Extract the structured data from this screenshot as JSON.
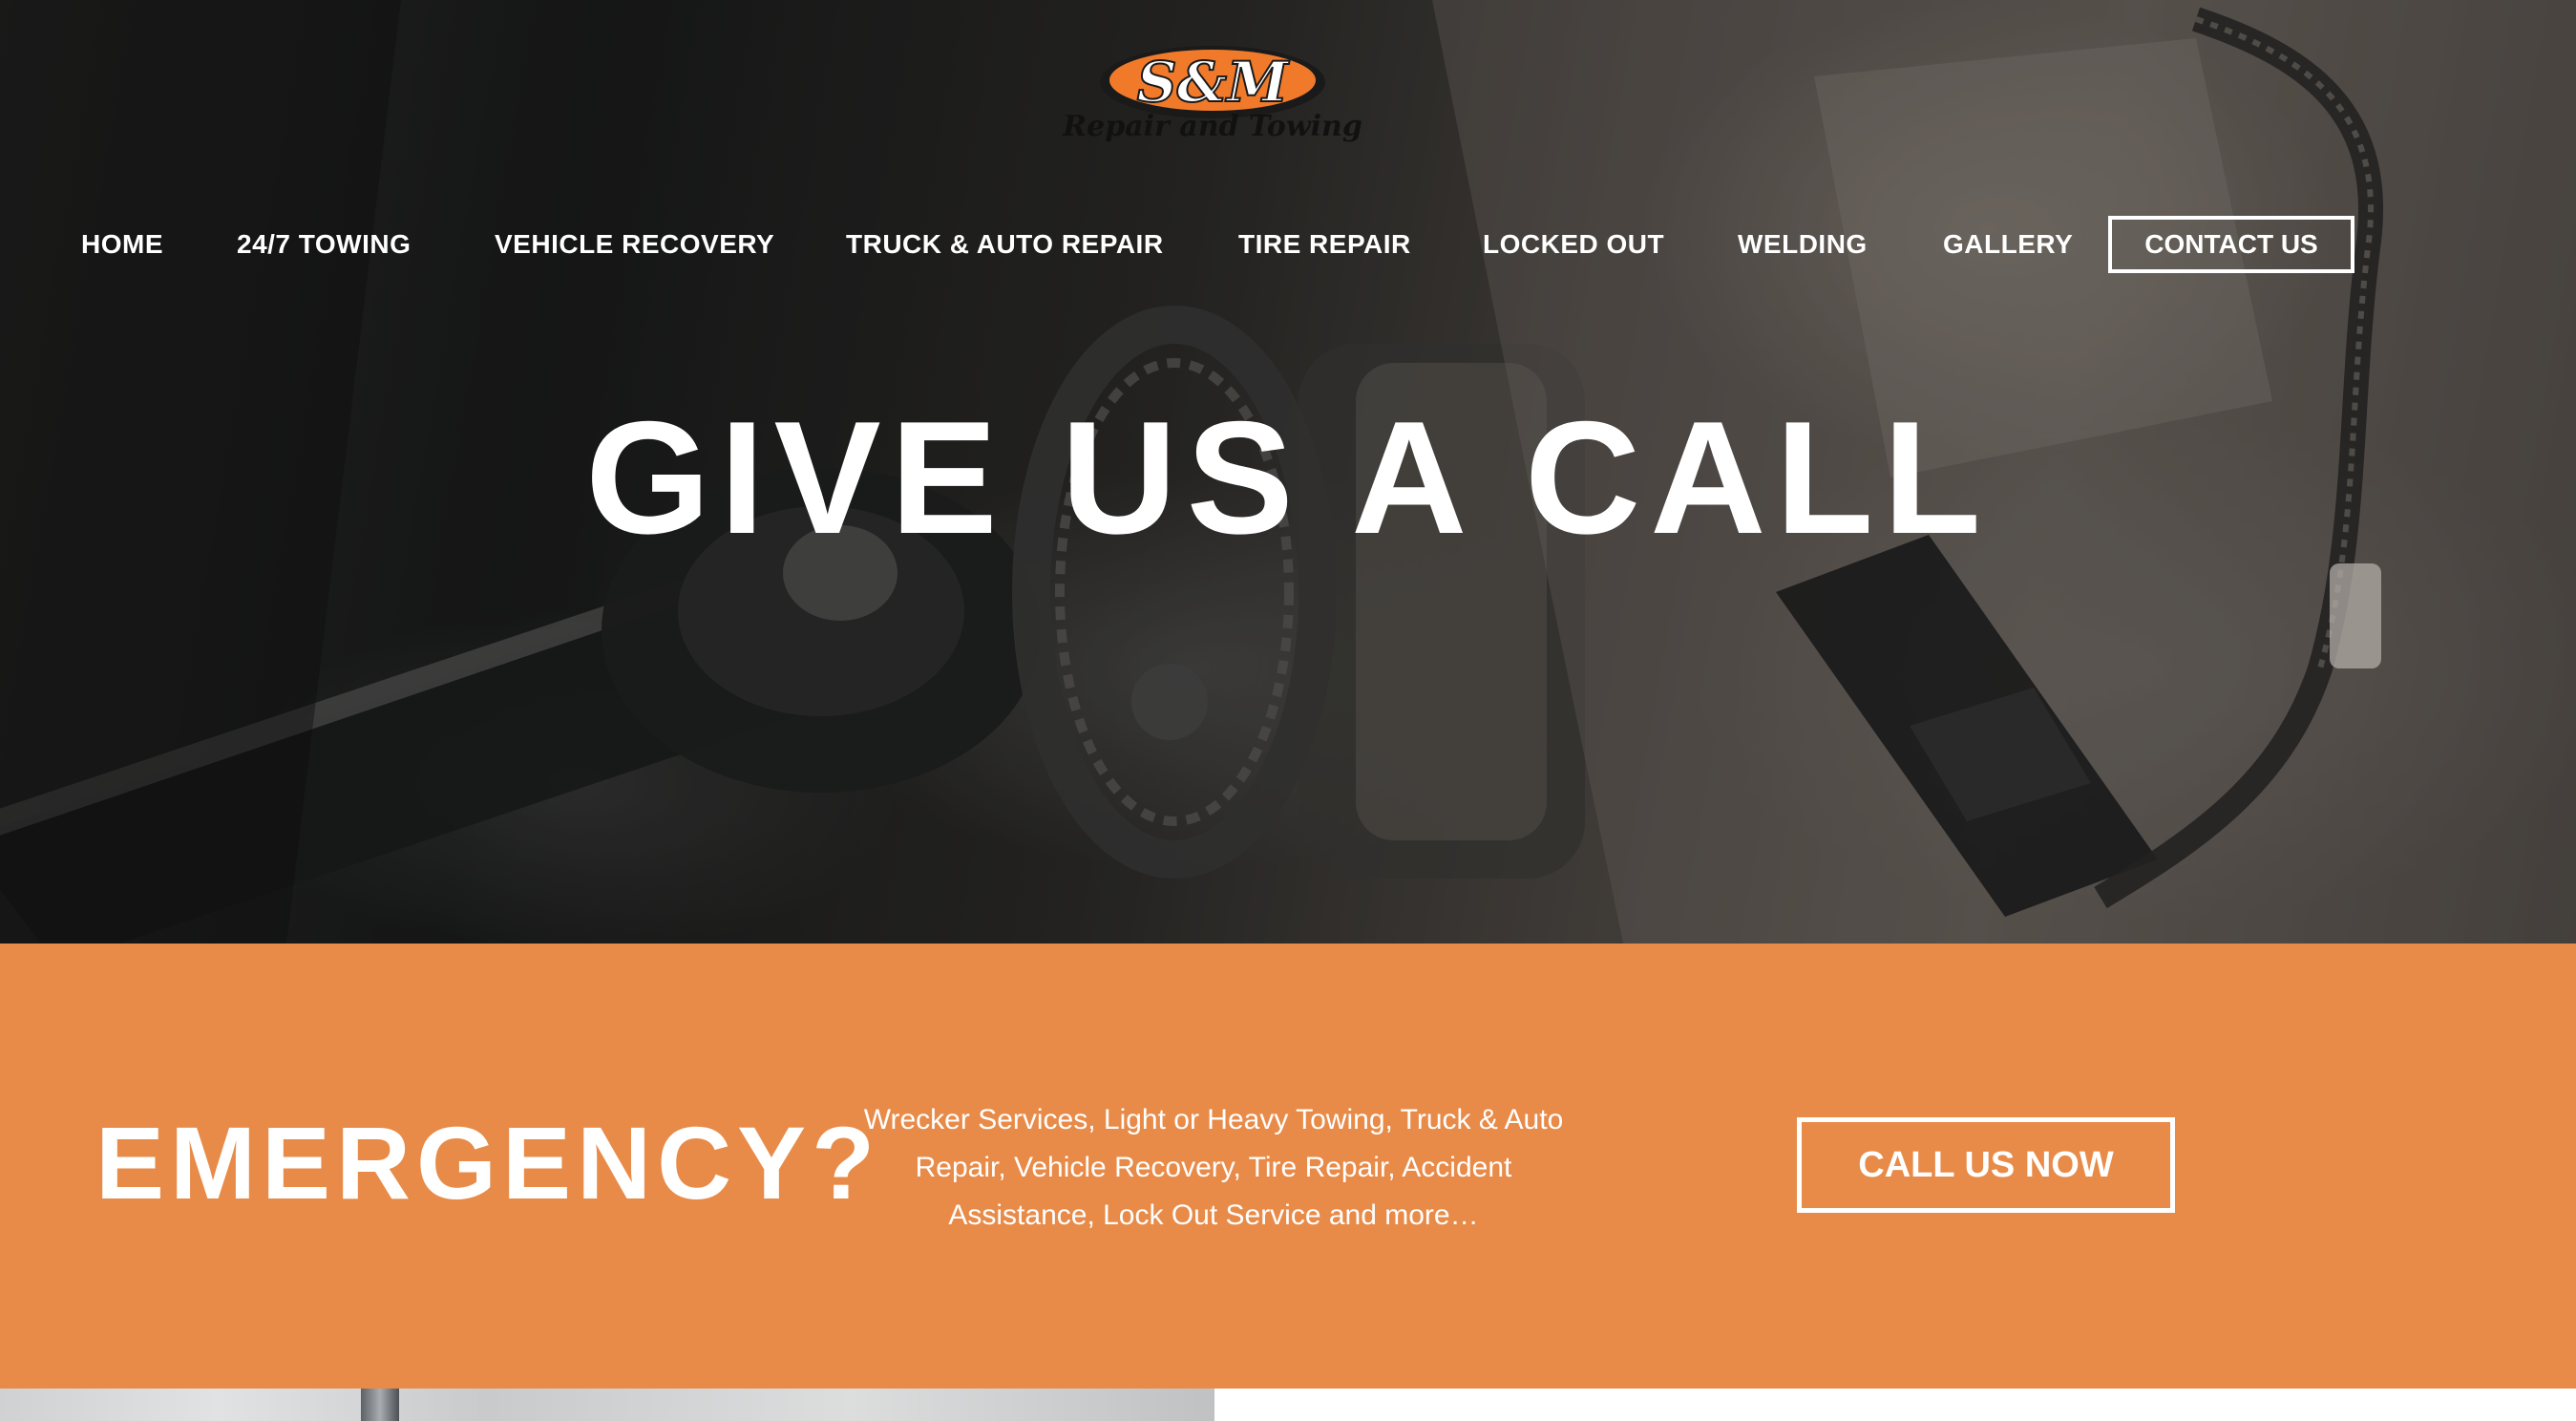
{
  "logo": {
    "brand": "S&M",
    "tagline": "Repair and Towing"
  },
  "nav": {
    "items": [
      {
        "label": "HOME"
      },
      {
        "label": "24/7 TOWING"
      },
      {
        "label": "VEHICLE RECOVERY"
      },
      {
        "label": "TRUCK & AUTO REPAIR"
      },
      {
        "label": "TIRE REPAIR"
      },
      {
        "label": "LOCKED OUT"
      },
      {
        "label": "WELDING"
      },
      {
        "label": "GALLERY"
      }
    ],
    "contact": "CONTACT US"
  },
  "hero": {
    "title": "GIVE US A CALL"
  },
  "emergency": {
    "title": "EMERGENCY?",
    "description": "Wrecker Services, Light or Heavy Towing, Truck & Auto Repair, Vehicle Recovery, Tire Repair, Accident Assistance, Lock Out Service and more…",
    "cta": "CALL US NOW"
  },
  "colors": {
    "accent_orange": "#e88b49",
    "logo_orange": "#f07a2a",
    "text_white": "#ffffff"
  }
}
